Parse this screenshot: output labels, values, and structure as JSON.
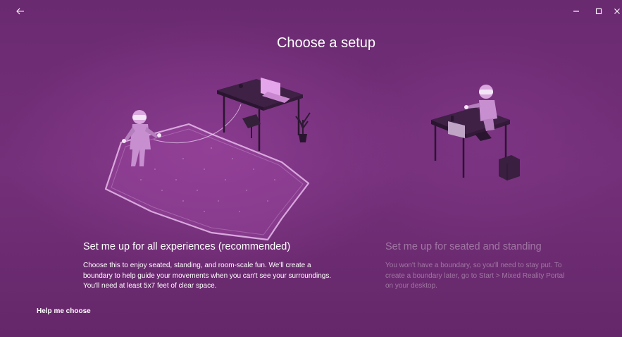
{
  "window": {
    "back_icon": "back-arrow-icon",
    "min_icon": "minimize-icon",
    "max_icon": "maximize-icon",
    "close_icon": "close-icon"
  },
  "page": {
    "title": "Choose a setup"
  },
  "options": [
    {
      "title": "Set me up for all experiences (recommended)",
      "description": "Choose this to enjoy seated, standing, and room-scale fun. We'll create a boundary to help guide your movements when you can't see your surroundings. You'll need at least 5x7 feet of clear space.",
      "state": "active"
    },
    {
      "title": "Set me up for seated and standing",
      "description": "You won't have a boundary, so you'll need to stay put. To create a boundary later, go to Start > Mixed Reality Portal on your desktop.",
      "state": "dimmed"
    }
  ],
  "help": {
    "label": "Help me choose"
  },
  "colors": {
    "background": "#6d2c73",
    "accent": "#ffffff",
    "illustration_light": "#c88fd0"
  }
}
